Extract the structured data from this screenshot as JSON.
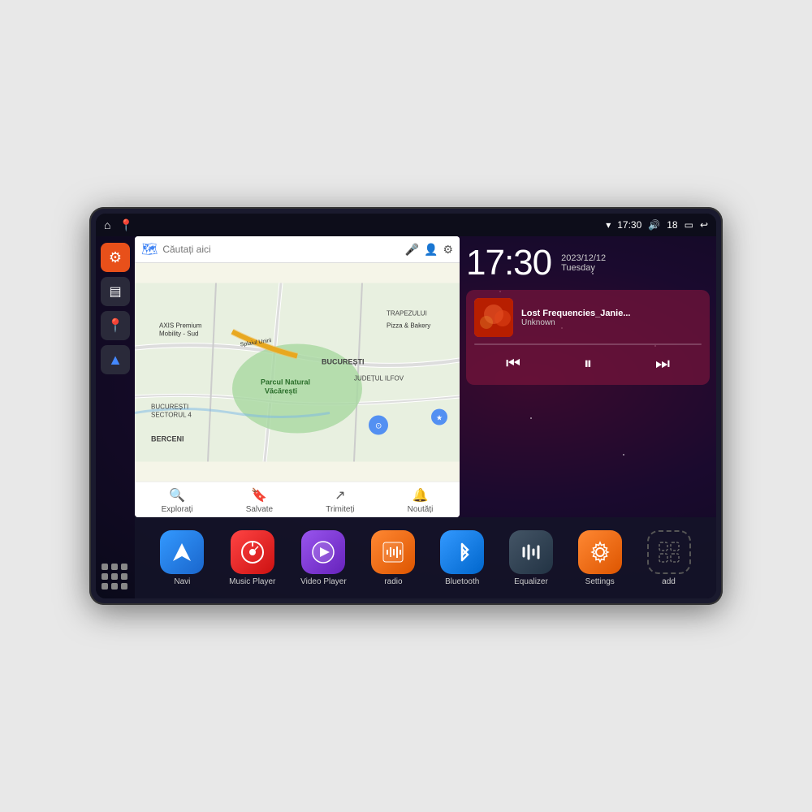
{
  "device": {
    "statusBar": {
      "time": "17:30",
      "signal": "▾",
      "wifi": "🔊",
      "battery_level": "18",
      "battery_icon": "🔋",
      "back_icon": "↩"
    },
    "sidebar": {
      "settings_label": "⚙",
      "files_label": "▤",
      "map_label": "📍",
      "nav_label": "▶",
      "grid_label": "⋮⋮⋮"
    },
    "map": {
      "search_placeholder": "Căutați aici",
      "places": [
        "AXIS Premium Mobility - Sud",
        "Pizza & Bakery",
        "Parcul Natural Văcărești",
        "BUCUREȘTI",
        "BUCUREȘTI SECTORUL 4",
        "BERCENI",
        "JUDEȚUL ILFOV",
        "TRAPEZULUI"
      ],
      "bottom_items": [
        {
          "icon": "📍",
          "label": "Explorați"
        },
        {
          "icon": "🔖",
          "label": "Salvate"
        },
        {
          "icon": "↗",
          "label": "Trimiteți"
        },
        {
          "icon": "🔔",
          "label": "Noutăți"
        }
      ]
    },
    "clock": {
      "time": "17:30",
      "date": "2023/12/12",
      "day": "Tuesday"
    },
    "music": {
      "title": "Lost Frequencies_Janie...",
      "artist": "Unknown",
      "controls": {
        "prev": "⏮",
        "play_pause": "⏸",
        "next": "⏭"
      }
    },
    "apps": [
      {
        "id": "navi",
        "label": "Navi",
        "icon_type": "blue-nav",
        "icon": "▲"
      },
      {
        "id": "music-player",
        "label": "Music Player",
        "icon_type": "red-music",
        "icon": "♪"
      },
      {
        "id": "video-player",
        "label": "Video Player",
        "icon_type": "purple-video",
        "icon": "▶"
      },
      {
        "id": "radio",
        "label": "radio",
        "icon_type": "orange-radio",
        "icon": "📻"
      },
      {
        "id": "bluetooth",
        "label": "Bluetooth",
        "icon_type": "blue-bt",
        "icon": "⚡"
      },
      {
        "id": "equalizer",
        "label": "Equalizer",
        "icon_type": "dark-eq",
        "icon": "≋"
      },
      {
        "id": "settings",
        "label": "Settings",
        "icon_type": "orange-settings",
        "icon": "⚙"
      },
      {
        "id": "add",
        "label": "add",
        "icon_type": "grey-add",
        "icon": "+"
      }
    ]
  }
}
